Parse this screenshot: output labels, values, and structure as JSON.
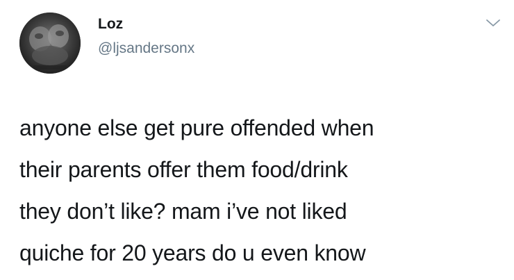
{
  "tweet": {
    "author": {
      "display_name": "Loz",
      "handle": "@ljsandersonx"
    },
    "text_lines": [
      "anyone else get pure offended when",
      "their parents offer them food/drink",
      "they don’t like? mam i’ve not liked",
      "quiche for 20 years do u even know"
    ],
    "menu_icon": "chevron-down-icon"
  },
  "colors": {
    "text_primary": "#14171a",
    "text_secondary": "#657786",
    "background": "#ffffff"
  }
}
